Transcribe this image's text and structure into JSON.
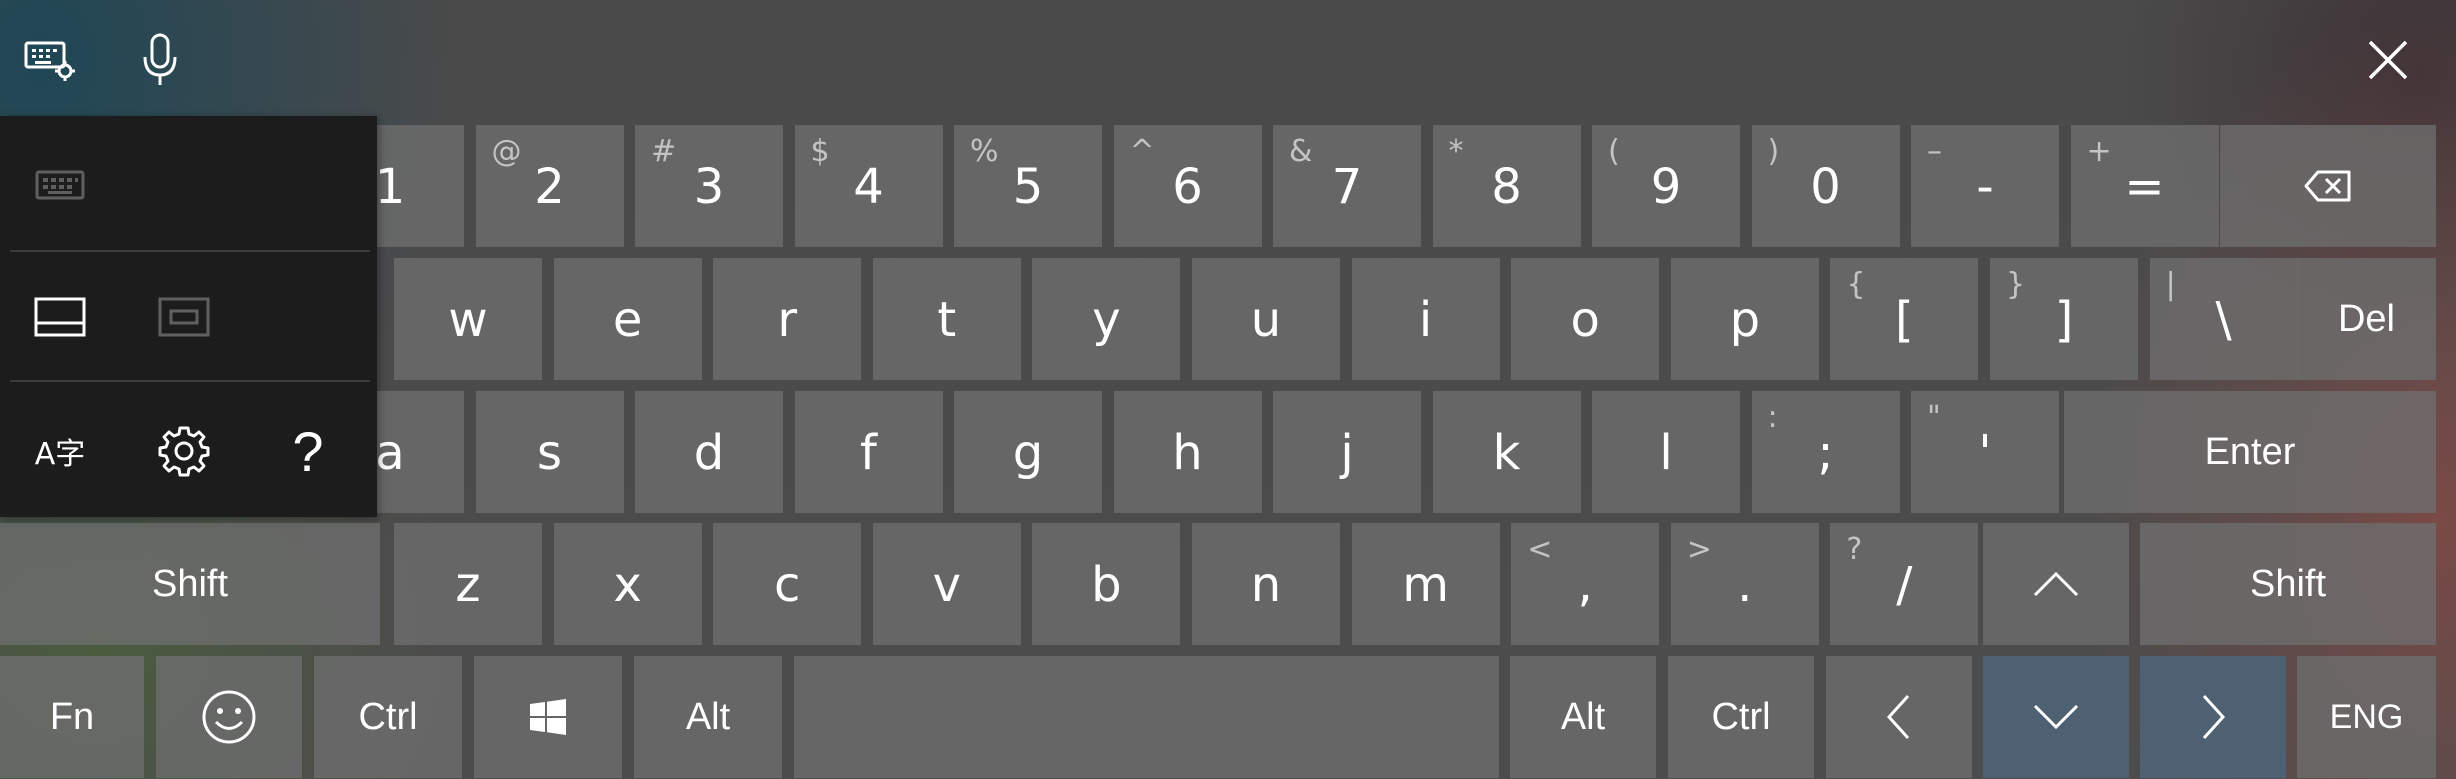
{
  "colors": {
    "key": "#6e6e6e",
    "key_highlight": "#4e6173",
    "panel": "#1c1c1c",
    "text": "#ffffff",
    "secondary_text": "#c4c4c4"
  },
  "toolbar": {
    "settings_icon": "keyboard-settings-icon",
    "mic_icon": "microphone-icon",
    "close_icon": "close-icon"
  },
  "panel": {
    "icons": [
      "keyboard-layout-icon",
      "docked-keyboard-icon",
      "undocked-keyboard-icon",
      "language-options-icon",
      "settings-icon",
      "help-icon"
    ],
    "help_glyph": "?",
    "lang_glyph": "A字"
  },
  "keys": {
    "row1": [
      {
        "main": "1",
        "shift": ""
      },
      {
        "main": "2",
        "shift": "@"
      },
      {
        "main": "3",
        "shift": "#"
      },
      {
        "main": "4",
        "shift": "$"
      },
      {
        "main": "5",
        "shift": "%"
      },
      {
        "main": "6",
        "shift": "^"
      },
      {
        "main": "7",
        "shift": "&"
      },
      {
        "main": "8",
        "shift": "*"
      },
      {
        "main": "9",
        "shift": "("
      },
      {
        "main": "0",
        "shift": ")"
      },
      {
        "main": "-",
        "shift": "–"
      },
      {
        "main": "=",
        "shift": "+"
      }
    ],
    "row2": [
      {
        "main": "w",
        "shift": ""
      },
      {
        "main": "e",
        "shift": ""
      },
      {
        "main": "r",
        "shift": ""
      },
      {
        "main": "t",
        "shift": ""
      },
      {
        "main": "y",
        "shift": ""
      },
      {
        "main": "u",
        "shift": ""
      },
      {
        "main": "i",
        "shift": ""
      },
      {
        "main": "o",
        "shift": ""
      },
      {
        "main": "p",
        "shift": ""
      },
      {
        "main": "[",
        "shift": "{"
      },
      {
        "main": "]",
        "shift": "}"
      },
      {
        "main": "\\",
        "shift": "|"
      }
    ],
    "row3": [
      {
        "main": "a",
        "shift": ""
      },
      {
        "main": "s",
        "shift": ""
      },
      {
        "main": "d",
        "shift": ""
      },
      {
        "main": "f",
        "shift": ""
      },
      {
        "main": "g",
        "shift": ""
      },
      {
        "main": "h",
        "shift": ""
      },
      {
        "main": "j",
        "shift": ""
      },
      {
        "main": "k",
        "shift": ""
      },
      {
        "main": "l",
        "shift": ""
      },
      {
        "main": ";",
        "shift": ":"
      },
      {
        "main": "'",
        "shift": "\""
      }
    ],
    "row4": [
      {
        "main": "z",
        "shift": ""
      },
      {
        "main": "x",
        "shift": ""
      },
      {
        "main": "c",
        "shift": ""
      },
      {
        "main": "v",
        "shift": ""
      },
      {
        "main": "b",
        "shift": ""
      },
      {
        "main": "n",
        "shift": ""
      },
      {
        "main": "m",
        "shift": ""
      },
      {
        "main": ",",
        "shift": "<"
      },
      {
        "main": ".",
        "shift": ">"
      },
      {
        "main": "/",
        "shift": "?"
      }
    ],
    "del": "Del",
    "enter": "Enter",
    "shift_left": "Shift",
    "shift_right": "Shift",
    "fn": "Fn",
    "ctrl_left": "Ctrl",
    "alt_left": "Alt",
    "alt_right": "Alt",
    "ctrl_right": "Ctrl",
    "lang": "ENG",
    "backspace_icon": "backspace-icon",
    "up_icon": "arrow-up-icon",
    "left_icon": "arrow-left-icon",
    "down_icon": "arrow-down-icon",
    "right_icon": "arrow-right-icon",
    "emoji_icon": "emoji-icon",
    "windows_icon": "windows-logo-icon"
  }
}
